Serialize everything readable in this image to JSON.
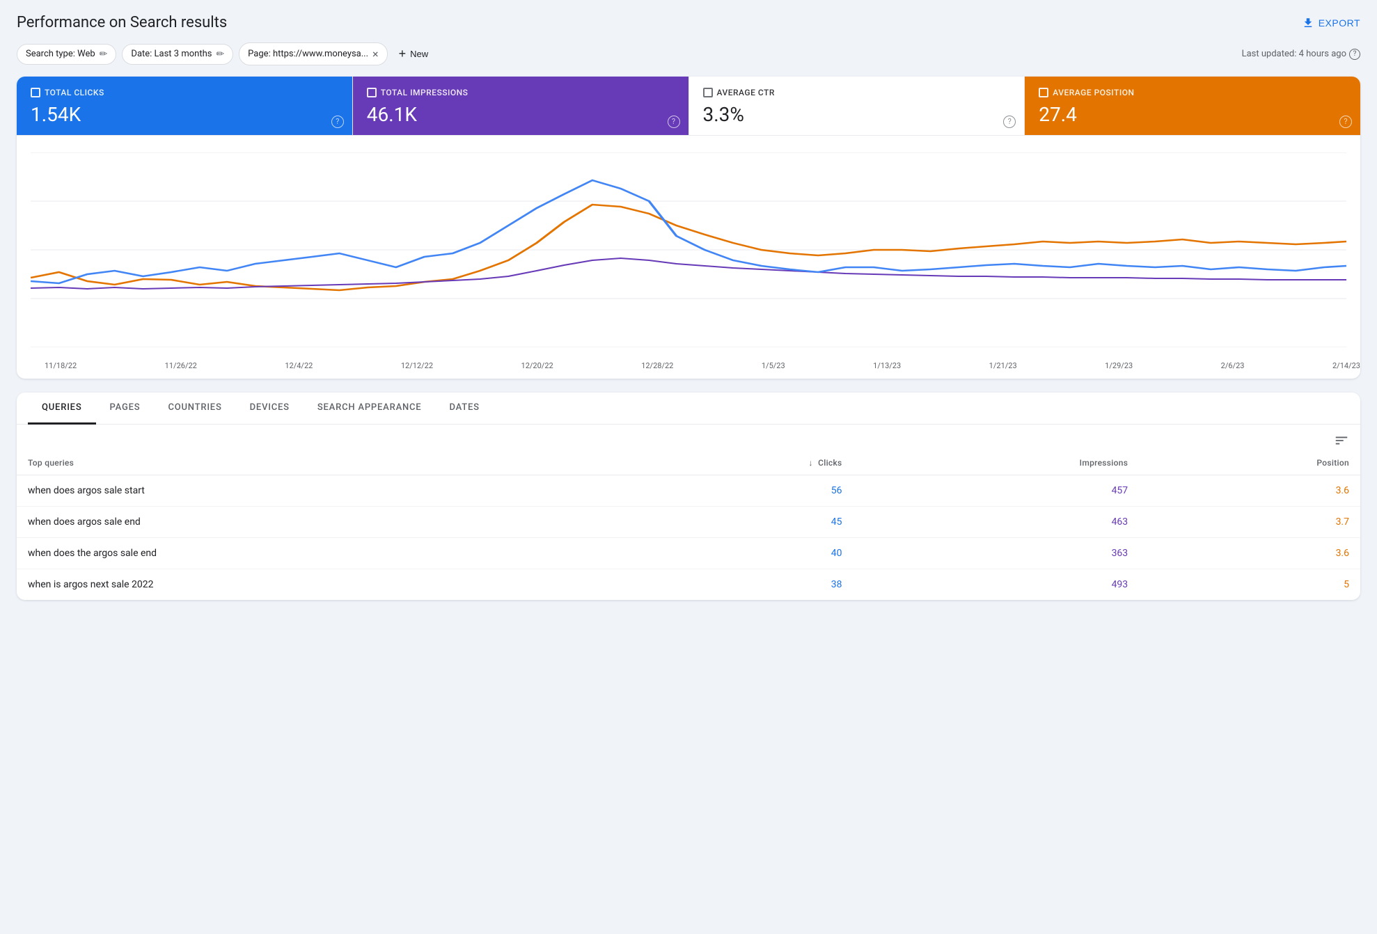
{
  "header": {
    "title": "Performance on Search results",
    "export_label": "EXPORT"
  },
  "filters": {
    "search_type": "Search type: Web",
    "date_range": "Date: Last 3 months",
    "page": "Page: https://www.moneysa...",
    "add_new_label": "New",
    "last_updated": "Last updated: 4 hours ago"
  },
  "metrics": [
    {
      "id": "clicks",
      "label": "Total clicks",
      "value": "1.54K",
      "style": "active-blue"
    },
    {
      "id": "impressions",
      "label": "Total impressions",
      "value": "46.1K",
      "style": "active-purple"
    },
    {
      "id": "ctr",
      "label": "Average CTR",
      "value": "3.3%",
      "style": "inactive"
    },
    {
      "id": "position",
      "label": "Average position",
      "value": "27.4",
      "style": "active-orange"
    }
  ],
  "chart": {
    "x_labels": [
      "11/18/22",
      "11/26/22",
      "12/4/22",
      "12/12/22",
      "12/20/22",
      "12/28/22",
      "1/5/23",
      "1/13/23",
      "1/21/23",
      "1/29/23",
      "2/6/23",
      "2/14/23"
    ],
    "series": {
      "clicks": {
        "color": "#4285f4",
        "points": [
          55,
          50,
          65,
          80,
          60,
          70,
          90,
          60,
          75,
          95,
          110,
          130,
          150,
          140,
          160,
          145,
          200,
          250,
          300,
          340,
          380,
          350,
          300,
          260,
          230,
          200,
          180,
          160,
          155,
          150,
          145,
          140,
          130,
          135,
          130,
          125,
          120,
          118,
          115,
          120,
          125,
          122,
          118,
          115,
          112,
          118,
          115,
          120
        ]
      },
      "impressions": {
        "color": "#673ab7",
        "points": [
          60,
          58,
          62,
          65,
          60,
          62,
          68,
          65,
          70,
          72,
          75,
          78,
          82,
          85,
          90,
          95,
          100,
          120,
          140,
          160,
          175,
          185,
          180,
          170,
          165,
          160,
          155,
          150,
          145,
          142,
          140,
          138,
          135,
          132,
          130,
          128,
          126,
          125,
          124,
          123,
          122,
          121,
          120,
          118,
          116,
          115,
          114,
          112
        ]
      },
      "position": {
        "color": "#e37400",
        "points": [
          70,
          68,
          75,
          80,
          72,
          75,
          85,
          80,
          90,
          95,
          100,
          110,
          130,
          150,
          180,
          200,
          230,
          280,
          320,
          360,
          390,
          380,
          350,
          300,
          270,
          240,
          210,
          190,
          180,
          175,
          180,
          185,
          190,
          188,
          195,
          200,
          205,
          210,
          205,
          200,
          195,
          198,
          202,
          205,
          200,
          205,
          210,
          208
        ]
      }
    }
  },
  "tabs": [
    {
      "id": "queries",
      "label": "QUERIES",
      "active": true
    },
    {
      "id": "pages",
      "label": "PAGES",
      "active": false
    },
    {
      "id": "countries",
      "label": "COUNTRIES",
      "active": false
    },
    {
      "id": "devices",
      "label": "DEVICES",
      "active": false
    },
    {
      "id": "search_appearance",
      "label": "SEARCH APPEARANCE",
      "active": false
    },
    {
      "id": "dates",
      "label": "DATES",
      "active": false
    }
  ],
  "table": {
    "top_queries_label": "Top queries",
    "columns": [
      {
        "id": "query",
        "label": "",
        "sortable": false
      },
      {
        "id": "clicks",
        "label": "Clicks",
        "sortable": true,
        "sorted": true
      },
      {
        "id": "impressions",
        "label": "Impressions",
        "sortable": false
      },
      {
        "id": "position",
        "label": "Position",
        "sortable": false
      }
    ],
    "rows": [
      {
        "query": "when does argos sale start",
        "clicks": "56",
        "impressions": "457",
        "position": "3.6"
      },
      {
        "query": "when does argos sale end",
        "clicks": "45",
        "impressions": "463",
        "position": "3.7"
      },
      {
        "query": "when does the argos sale end",
        "clicks": "40",
        "impressions": "363",
        "position": "3.6"
      },
      {
        "query": "when is argos next sale 2022",
        "clicks": "38",
        "impressions": "493",
        "position": "5"
      }
    ]
  }
}
